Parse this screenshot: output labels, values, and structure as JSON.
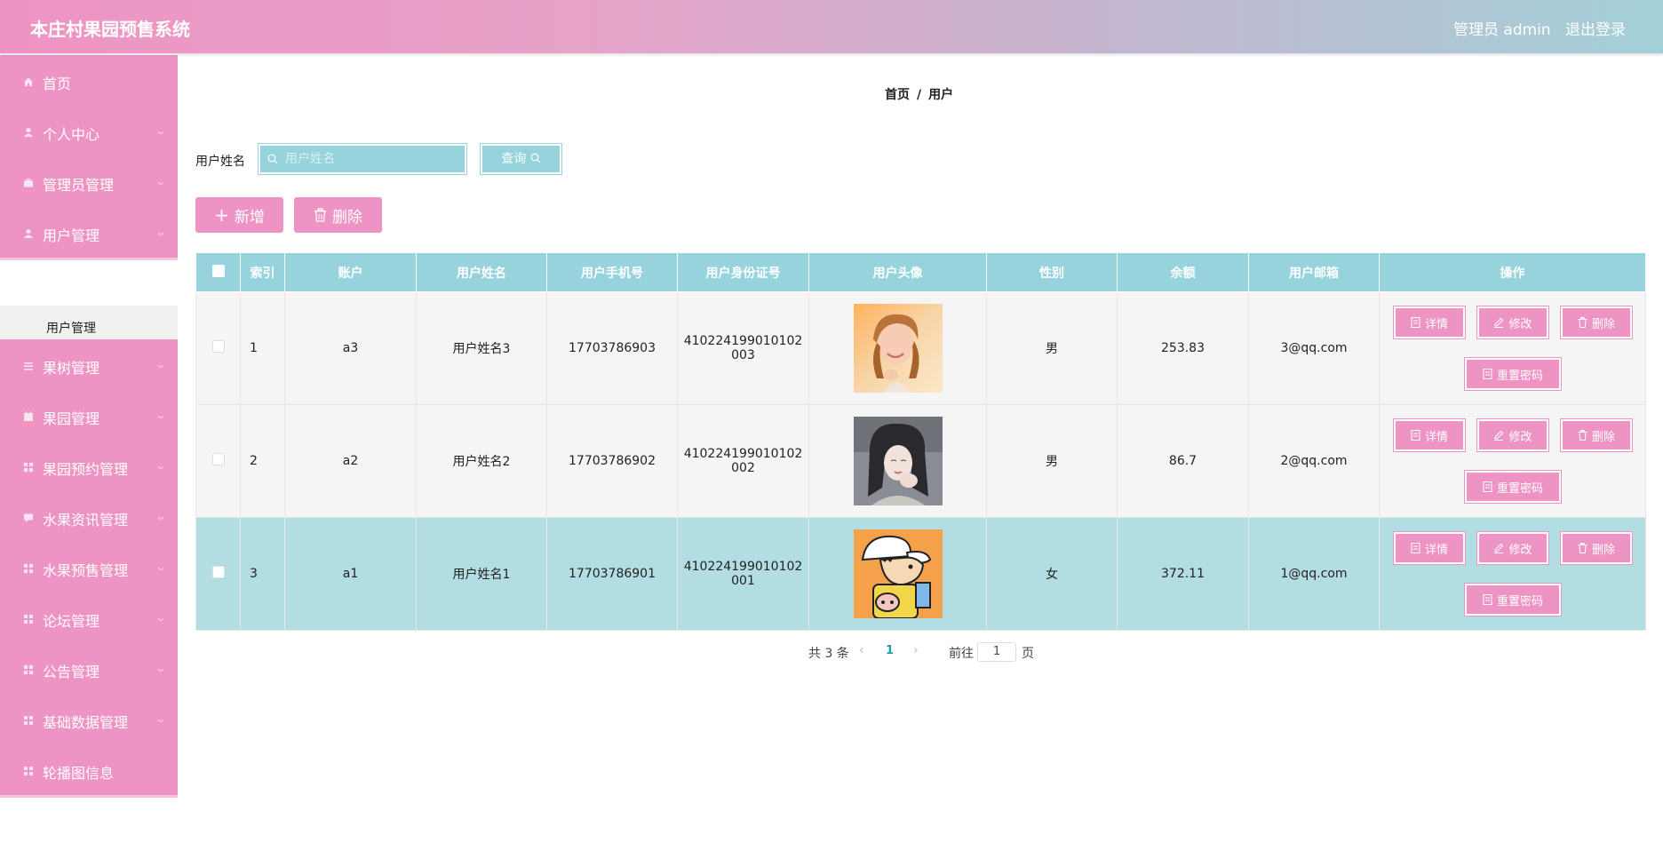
{
  "header": {
    "title": "本庄村果园预售系统",
    "admin_label": "管理员 admin",
    "logout_label": "退出登录"
  },
  "sidebar": {
    "items": [
      {
        "label": "首页",
        "icon": "home-icon"
      },
      {
        "label": "个人中心",
        "icon": "user-icon"
      },
      {
        "label": "管理员管理",
        "icon": "briefcase-icon"
      },
      {
        "label": "用户管理",
        "icon": "user-icon"
      },
      {
        "label": "果树管理",
        "icon": "list-icon"
      },
      {
        "label": "果园管理",
        "icon": "calendar-icon"
      },
      {
        "label": "果园预约管理",
        "icon": "grid-icon"
      },
      {
        "label": "水果资讯管理",
        "icon": "chat-icon"
      },
      {
        "label": "水果预售管理",
        "icon": "grid-icon"
      },
      {
        "label": "论坛管理",
        "icon": "grid-icon"
      },
      {
        "label": "公告管理",
        "icon": "grid-icon"
      },
      {
        "label": "基础数据管理",
        "icon": "grid-icon"
      },
      {
        "label": "轮播图信息",
        "icon": "grid-icon"
      }
    ],
    "sub_item": "用户管理"
  },
  "breadcrumb": {
    "home": "首页",
    "separator": "/",
    "current": "用户"
  },
  "search": {
    "label": "用户姓名",
    "placeholder": "用户姓名",
    "value": "",
    "button_label": "查询"
  },
  "toolbar": {
    "add_label": "新增",
    "delete_label": "删除"
  },
  "table": {
    "headers": [
      "",
      "索引",
      "账户",
      "用户姓名",
      "用户手机号",
      "用户身份证号",
      "用户头像",
      "性别",
      "余额",
      "用户邮箱",
      "操作"
    ],
    "rows": [
      {
        "index": "1",
        "account": "a3",
        "name": "用户姓名3",
        "phone": "17703786903",
        "id_line1": "410224199010102",
        "id_line2": "003",
        "avatar": "avatar-girl-sunlight",
        "gender": "男",
        "balance": "253.83",
        "email": "3@qq.com"
      },
      {
        "index": "2",
        "account": "a2",
        "name": "用户姓名2",
        "phone": "17703786902",
        "id_line1": "410224199010102",
        "id_line2": "002",
        "avatar": "avatar-girl-dark",
        "gender": "男",
        "balance": "86.7",
        "email": "2@qq.com"
      },
      {
        "index": "3",
        "account": "a1",
        "name": "用户姓名1",
        "phone": "17703786901",
        "id_line1": "410224199010102",
        "id_line2": "001",
        "avatar": "avatar-cartoon-boy",
        "gender": "女",
        "balance": "372.11",
        "email": "1@qq.com"
      }
    ],
    "actions": {
      "detail": "详情",
      "edit": "修改",
      "delete": "删除",
      "reset": "重置密码"
    }
  },
  "pagination": {
    "total": "共 3 条",
    "current_page": "1",
    "goto_label": "前往",
    "goto_value": "1",
    "page_unit": "页"
  },
  "colors": {
    "primary_pink": "#ee94c4",
    "teal": "#96d3dc",
    "highlight_row": "#b2dde2"
  }
}
